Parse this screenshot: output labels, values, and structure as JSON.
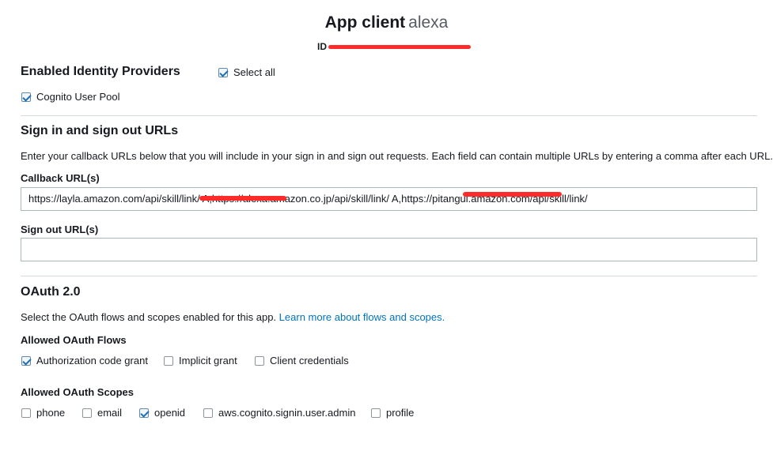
{
  "header": {
    "title": "App client",
    "client_name": "alexa",
    "id_label": "ID"
  },
  "identity_providers": {
    "heading": "Enabled Identity Providers",
    "select_all_label": "Select all",
    "select_all_checked": true,
    "providers": [
      {
        "label": "Cognito User Pool",
        "checked": true
      }
    ]
  },
  "urls": {
    "heading": "Sign in and sign out URLs",
    "description": "Enter your callback URLs below that you will include in your sign in and sign out requests. Each field can contain multiple URLs by entering a comma after each URL.",
    "callback_label": "Callback URL(s)",
    "callback_value": "https://layla.amazon.com/api/skill/link/                              A,https://alexa.amazon.co.jp/api/skill/link/                              A,https://pitangui.amazon.com/api/skill/link/",
    "signout_label": "Sign out URL(s)",
    "signout_value": ""
  },
  "oauth": {
    "heading": "OAuth 2.0",
    "description": "Select the OAuth flows and scopes enabled for this app.",
    "learn_more_link": "Learn more about flows and scopes.",
    "flows_label": "Allowed OAuth Flows",
    "flows": [
      {
        "label": "Authorization code grant",
        "checked": true
      },
      {
        "label": "Implicit grant",
        "checked": false
      },
      {
        "label": "Client credentials",
        "checked": false
      }
    ],
    "scopes_label": "Allowed OAuth Scopes",
    "scopes": [
      {
        "label": "phone",
        "checked": false
      },
      {
        "label": "email",
        "checked": false
      },
      {
        "label": "openid",
        "checked": true
      },
      {
        "label": "aws.cognito.signin.user.admin",
        "checked": false
      },
      {
        "label": "profile",
        "checked": false
      }
    ]
  },
  "colors": {
    "link": "#0073bb",
    "redaction": "#ff2a2a",
    "checkbox_check": "#1f6fb2"
  }
}
